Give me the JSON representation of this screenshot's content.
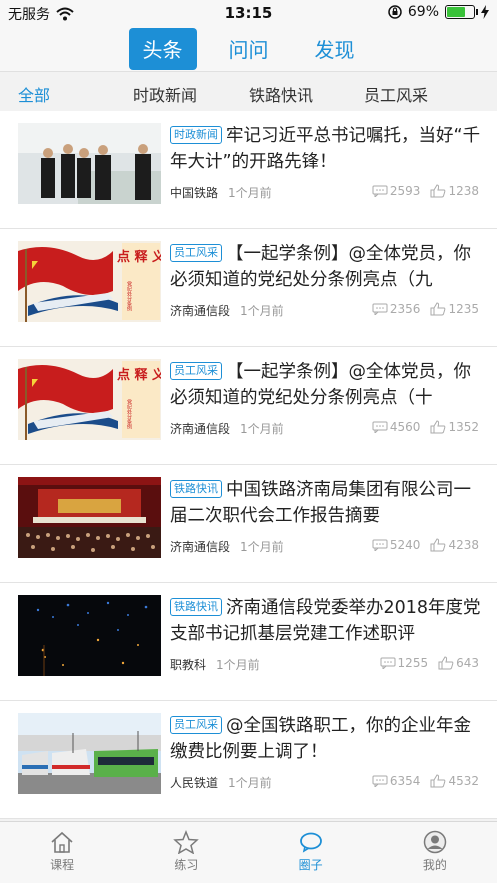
{
  "status_bar": {
    "carrier": "无服务",
    "time": "13:15",
    "battery": "69%",
    "battery_level": 0.69
  },
  "top_tabs": [
    {
      "label": "头条",
      "active": true
    },
    {
      "label": "问问",
      "active": false
    },
    {
      "label": "发现",
      "active": false
    }
  ],
  "category_tabs": [
    {
      "label": "全部",
      "active": true
    },
    {
      "label": "时政新闻",
      "active": false
    },
    {
      "label": "铁路快讯",
      "active": false
    },
    {
      "label": "员工风采",
      "active": false
    }
  ],
  "articles": [
    {
      "tag": "时政新闻",
      "title": "牢记习近平总书记嘱托，当好“千年大计”的开路先锋！",
      "source": "中国铁路",
      "age": "1个月前",
      "comments": "2593",
      "likes": "1238"
    },
    {
      "tag": "员工风采",
      "title": "【一起学条例】@全体党员，你必须知道的党纪处分条例亮点（九",
      "source": "济南通信段",
      "age": "1个月前",
      "comments": "2356",
      "likes": "1235"
    },
    {
      "tag": "员工风采",
      "title": "【一起学条例】@全体党员，你必须知道的党纪处分条例亮点（十",
      "source": "济南通信段",
      "age": "1个月前",
      "comments": "4560",
      "likes": "1352"
    },
    {
      "tag": "铁路快讯",
      "title": "中国铁路济南局集团有限公司一届二次职代会工作报告摘要",
      "source": "济南通信段",
      "age": "1个月前",
      "comments": "5240",
      "likes": "4238"
    },
    {
      "tag": "铁路快讯",
      "title": "济南通信段党委举办2018年度党支部书记抓基层党建工作述职评",
      "source": "职教科",
      "age": "1个月前",
      "comments": "1255",
      "likes": "643"
    },
    {
      "tag": "员工风采",
      "title": "@全国铁路职工，你的企业年金缴费比例要上调了！",
      "source": "人民铁道",
      "age": "1个月前",
      "comments": "6354",
      "likes": "4532"
    }
  ],
  "thumb_texts": {
    "banner": "点 释 义",
    "banner_side": "党纪处分条例"
  },
  "tabbar": [
    {
      "label": "课程",
      "icon": "home-icon",
      "active": false
    },
    {
      "label": "练习",
      "icon": "star-icon",
      "active": false
    },
    {
      "label": "圈子",
      "icon": "chat-bubble-icon",
      "active": true
    },
    {
      "label": "我的",
      "icon": "person-icon",
      "active": false
    }
  ],
  "colors": {
    "accent": "#1d8fd6",
    "tag_border": "#1d8fd6",
    "battery_green": "#3ac23a"
  }
}
